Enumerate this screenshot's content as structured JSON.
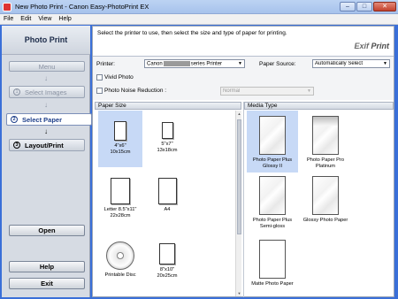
{
  "window": {
    "title": "New Photo Print - Canon Easy-PhotoPrint EX",
    "minimize": "‒",
    "maximize": "□",
    "close": "✕"
  },
  "menubar": [
    "File",
    "Edit",
    "View",
    "Help"
  ],
  "left": {
    "title": "Photo Print",
    "menu_label": "Menu",
    "steps": [
      {
        "num": "1",
        "label": "Select Images"
      },
      {
        "num": "2",
        "label": "Select Paper"
      },
      {
        "num": "3",
        "label": "Layout/Print"
      }
    ],
    "arrow": "↓",
    "open_label": "Open",
    "help_label": "Help",
    "exit_label": "Exit"
  },
  "main": {
    "instruction": "Select the printer to use, then select the size and type of paper for printing.",
    "logo": {
      "exif": "Exif",
      "print": "Print"
    },
    "printer_label": "Printer:",
    "printer_prefix": "Canon",
    "printer_suffix": "series Printer",
    "paper_source_label": "Paper Source:",
    "paper_source_value": "Automatically Select",
    "vivid_photo": "Vivid Photo",
    "noise_reduction": "Photo Noise Reduction :",
    "noise_value": "Normal",
    "paper_size_header": "Paper Size",
    "media_type_header": "Media Type",
    "dropdown_glyph": "▼",
    "scroll_up": "▲",
    "scroll_down": "▼"
  },
  "paper_sizes": [
    {
      "label": "4\"x6\"\n10x15cm",
      "selected": true
    },
    {
      "label": "5\"x7\"\n13x18cm",
      "selected": false
    },
    {
      "label": "Letter 8.5\"x11\"\n22x28cm",
      "selected": false
    },
    {
      "label": "A4",
      "selected": false
    },
    {
      "label": "Printable Disc",
      "selected": false
    },
    {
      "label": "8\"x10\"\n20x25cm",
      "selected": false
    }
  ],
  "media_types": [
    {
      "label": "Photo Paper Plus\nGlossy II",
      "selected": true,
      "style": "glossy"
    },
    {
      "label": "Photo Paper Pro\nPlatinum",
      "selected": false,
      "style": "plat"
    },
    {
      "label": "Photo Paper Plus\nSemi-gloss",
      "selected": false,
      "style": "glossy"
    },
    {
      "label": "Glossy Photo Paper",
      "selected": false,
      "style": "glossy"
    },
    {
      "label": "Matte Photo Paper",
      "selected": false,
      "style": "matte"
    }
  ]
}
